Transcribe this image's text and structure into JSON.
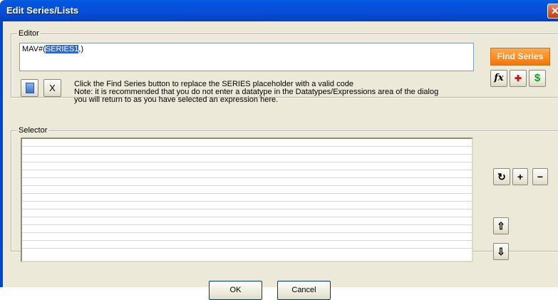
{
  "window": {
    "title": "Edit Series/Lists",
    "close_glyph": "✕"
  },
  "editor": {
    "legend": "Editor",
    "expression_prefix": "MAV#(",
    "expression_selected": "SERIES1",
    "expression_suffix": ",)",
    "find_series_label": "Find Series",
    "fx_label": "fx",
    "spell_glyph": "✚",
    "dollar_label": "$",
    "copy_icon": "document-icon",
    "clear_label": "X",
    "hint_lines": [
      "Click the Find Series button to replace the SERIES placeholder with a valid code",
      "Note: it is recommended that you do not enter a datatype in the Datatypes/Expressions area of the dialog",
      "you will return to as you have selected an expression here."
    ]
  },
  "selector": {
    "legend": "Selector",
    "items": [],
    "refresh_glyph": "↻",
    "add_label": "+",
    "remove_label": "−",
    "move_up_glyph": "⇧",
    "move_down_glyph": "⇩"
  },
  "footer": {
    "ok_label": "OK",
    "cancel_label": "Cancel"
  },
  "colors": {
    "title_bar": "#0046c8",
    "find_series": "#ff8a1e",
    "selection": "#316ac5"
  }
}
